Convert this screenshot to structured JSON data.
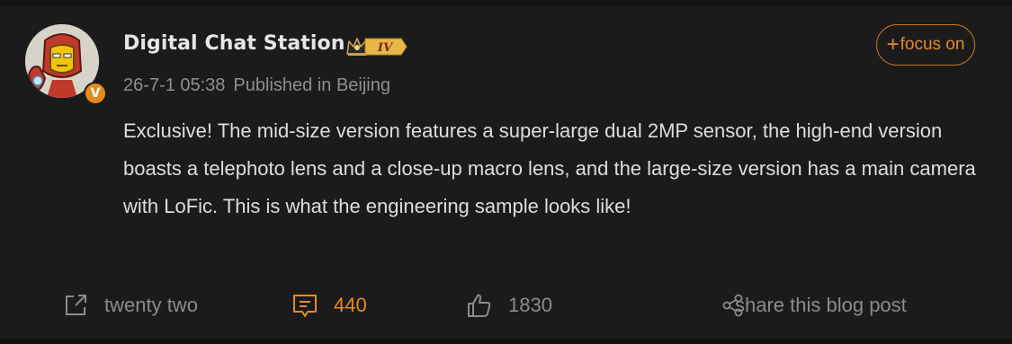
{
  "author": {
    "name": "Digital Chat Station",
    "rank_badge": "IV",
    "verified_mark": "V"
  },
  "meta": {
    "timestamp": "26-7-1 05:38",
    "location": "Published in Beijing"
  },
  "follow": {
    "plus": "+",
    "label": "focus on"
  },
  "post": {
    "text": "Exclusive! The mid-size version features a super-large dual 2MP sensor, the high-end version boasts a telephoto lens and a close-up macro lens, and the large-size version has a main camera with LoFic. This is what the engineering sample looks like!"
  },
  "actions": {
    "repost_label": "twenty two",
    "comment_count": "440",
    "like_count": "1830",
    "share_label": "share this blog post"
  },
  "icons": {
    "repost": "external-link-icon",
    "comment": "comment-icon",
    "like": "thumbs-up-icon",
    "share": "share-icon"
  },
  "colors": {
    "background": "#1b1b1b",
    "accent": "#e58a2a",
    "text": "#dedede",
    "muted": "#8f8f8f"
  }
}
